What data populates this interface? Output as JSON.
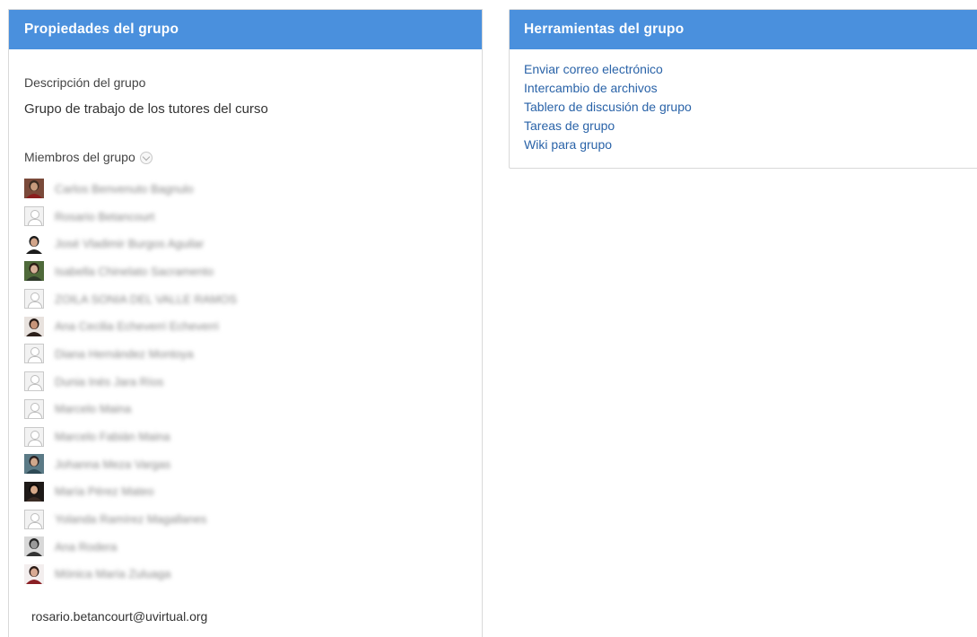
{
  "left_panel": {
    "title": "Propiedades del grupo",
    "description_label": "Descripción del grupo",
    "description_value": "Grupo de trabajo de los tutores del curso",
    "members_label": "Miembros del grupo",
    "members_toggle_icon": "chevron-down-icon",
    "members": [
      {
        "name": "Carlos Benvenuto Bagnulo",
        "avatar": "photo-man-red"
      },
      {
        "name": "Rosario Betancourt",
        "avatar": "default-user"
      },
      {
        "name": "José Vladimir Burgos Aguilar",
        "avatar": "photo-man-suit"
      },
      {
        "name": "Isabella Chinelato Sacramento",
        "avatar": "photo-woman-green"
      },
      {
        "name": "ZOILA SONIA DEL VALLE RAMOS",
        "avatar": "default-user"
      },
      {
        "name": "Ana Cecilia Echeverri Echeverri",
        "avatar": "photo-woman-dark"
      },
      {
        "name": "Diana Hernández Montoya",
        "avatar": "default-user"
      },
      {
        "name": "Dunia Inés Jara Ríos",
        "avatar": "default-user"
      },
      {
        "name": "Marcelo Maina",
        "avatar": "default-user"
      },
      {
        "name": "Marcelo Fabián Maina",
        "avatar": "default-user"
      },
      {
        "name": "Johanna Meza Vargas",
        "avatar": "photo-woman-teal"
      },
      {
        "name": "María Pérez Mateo",
        "avatar": "photo-woman-black"
      },
      {
        "name": "Yolanda Ramírez Magallanes",
        "avatar": "default-user"
      },
      {
        "name": "Ana Rodera",
        "avatar": "photo-woman-bw"
      },
      {
        "name": "Mónica María Zuluaga",
        "avatar": "photo-woman-red"
      }
    ],
    "email": "rosario.betancourt@uvirtual.org"
  },
  "right_panel": {
    "title": "Herramientas del grupo",
    "links": [
      "Enviar correo electrónico",
      "Intercambio de archivos",
      "Tablero de discusión de grupo",
      "Tareas de grupo",
      "Wiki para grupo"
    ]
  },
  "colors": {
    "header_bg": "#4a90dd",
    "header_text": "#ffffff",
    "link": "#2a63a8",
    "panel_border": "#d9d9d9"
  }
}
